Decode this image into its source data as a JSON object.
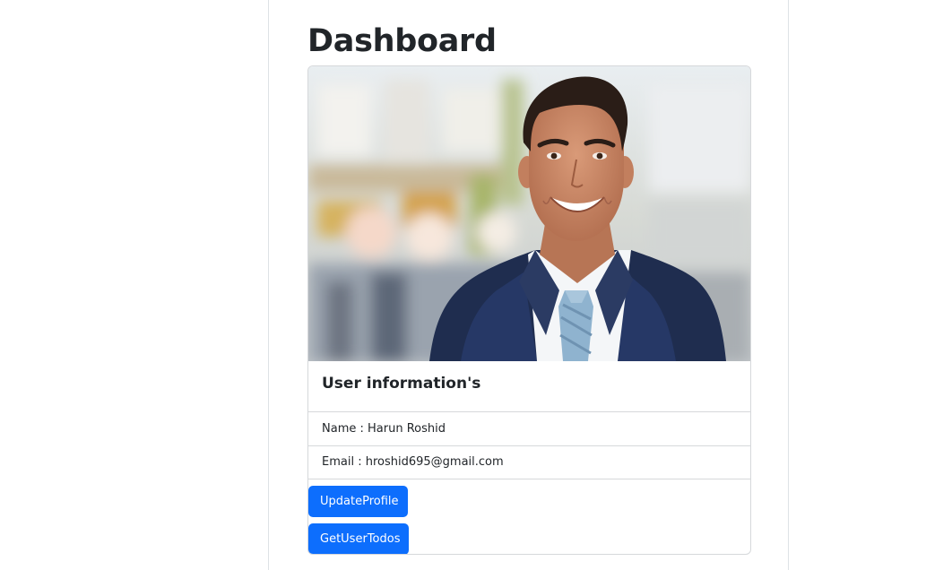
{
  "header": {
    "title": "Dashboard"
  },
  "card": {
    "image_alt": "profile-photo",
    "title": "User information's",
    "name_line": "Name : Harun Roshid",
    "email_line": "Email : hroshid695@gmail.com"
  },
  "actions": {
    "update_profile_label": "UpdateProfile",
    "get_user_todos_label": "GetUserTodos"
  },
  "colors": {
    "primary": "#0d6efd",
    "text": "#212529",
    "border": "#dee2e6"
  }
}
